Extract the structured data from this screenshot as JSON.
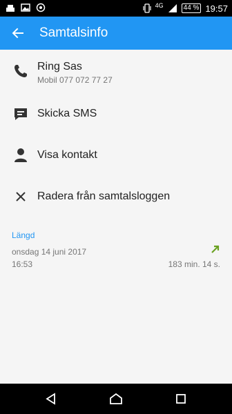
{
  "status_bar": {
    "network": "4G",
    "battery": "44 %",
    "time": "19:57"
  },
  "app_bar": {
    "title": "Samtalsinfo"
  },
  "actions": [
    {
      "label": "Ring Sas",
      "sub": "Mobil 077 072 77 27",
      "icon": "phone-icon"
    },
    {
      "label": "Skicka SMS",
      "icon": "sms-icon"
    },
    {
      "label": "Visa kontakt",
      "icon": "person-icon"
    },
    {
      "label": "Radera från samtalsloggen",
      "icon": "close-icon"
    }
  ],
  "call_log": {
    "section_label": "Längd",
    "date": "onsdag 14 juni 2017",
    "time": "16:53",
    "duration": "183 min. 14 s.",
    "direction_icon": "outgoing-call-arrow-icon",
    "direction_color": "#6aa121"
  },
  "colors": {
    "accent": "#2196f3",
    "background": "#f5f5f5"
  }
}
